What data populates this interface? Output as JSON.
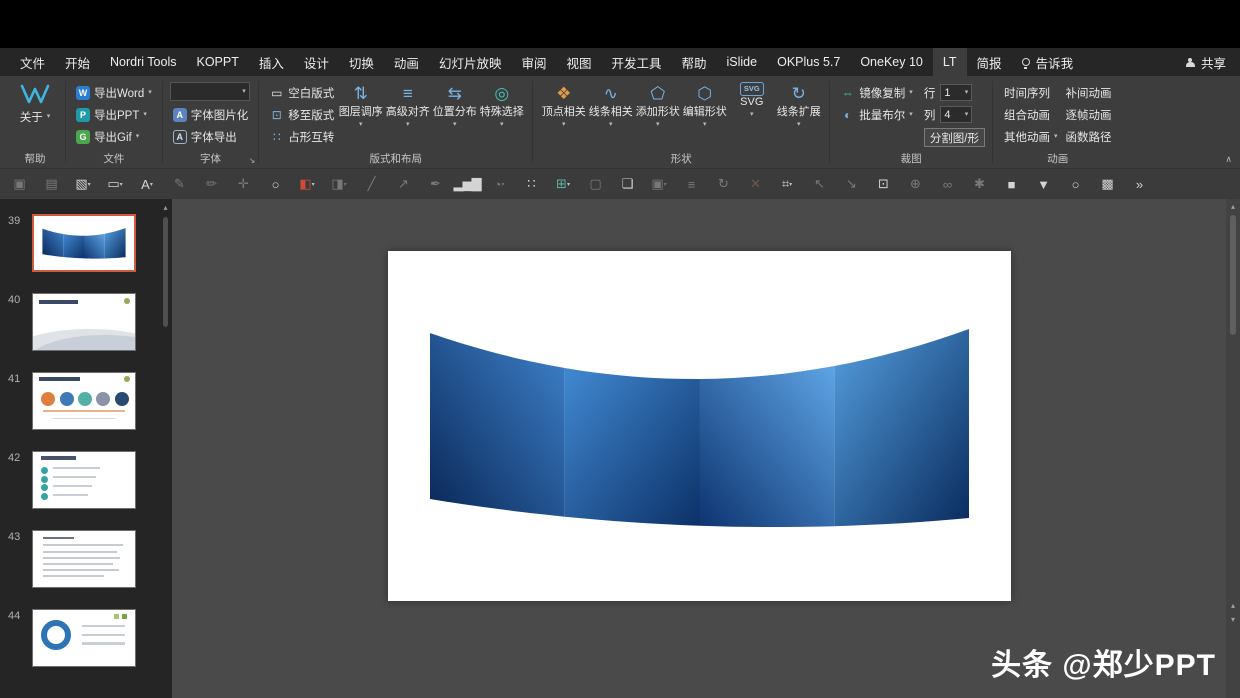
{
  "tabs": {
    "items": [
      "文件",
      "开始",
      "Nordri Tools",
      "KOPPT",
      "插入",
      "设计",
      "切换",
      "动画",
      "幻灯片放映",
      "审阅",
      "视图",
      "开发工具",
      "帮助",
      "iSlide",
      "OKPlus 5.7",
      "OneKey 10",
      "LT",
      "简报"
    ],
    "active": "LT",
    "tellme": "告诉我",
    "share": "共享"
  },
  "ribbon": {
    "about": {
      "button": "关于",
      "group_label": "帮助"
    },
    "file": {
      "group_label": "文件",
      "buttons": [
        {
          "icon": "W",
          "label": "导出Word"
        },
        {
          "icon": "P",
          "label": "导出PPT"
        },
        {
          "icon": "G",
          "label": "导出Gif"
        }
      ]
    },
    "font": {
      "group_label": "字体",
      "combo_value": "",
      "buttons": [
        {
          "icon": "A",
          "label": "字体图片化"
        },
        {
          "icon": "A",
          "label": "字体导出"
        }
      ]
    },
    "layout": {
      "group_label": "版式和布局",
      "small_buttons": [
        {
          "glyph": "▭",
          "label": "空白版式"
        },
        {
          "glyph": "⊡",
          "label": "移至版式"
        },
        {
          "glyph": "∷",
          "label": "占形互转"
        }
      ],
      "big_buttons": [
        {
          "glyph": "⇅",
          "label": "图层调序"
        },
        {
          "glyph": "≡",
          "label": "高级对齐"
        },
        {
          "glyph": "⇆",
          "label": "位置分布"
        },
        {
          "glyph": "◎",
          "label": "特殊选择"
        }
      ]
    },
    "shape": {
      "group_label": "形状",
      "big_buttons": [
        {
          "glyph": "❖",
          "label": "顶点相关"
        },
        {
          "glyph": "∿",
          "label": "线条相关"
        },
        {
          "glyph": "⬠",
          "label": "添加形状"
        },
        {
          "glyph": "⬡",
          "label": "编辑形状"
        },
        {
          "glyph": "SVG",
          "label": "SVG"
        },
        {
          "glyph": "↻",
          "label": "线条扩展"
        }
      ]
    },
    "crop": {
      "group_label": "裁图",
      "buttons": [
        {
          "glyph": "⇔",
          "label": "镜像复制"
        },
        {
          "glyph": "◐",
          "label": "批量布尔"
        }
      ],
      "row_label": "行",
      "row_value": "1",
      "col_label": "列",
      "col_value": "4",
      "split_button": "分割图/形"
    },
    "anim": {
      "group_label": "动画",
      "col1": [
        {
          "label": "时间序列"
        },
        {
          "label": "组合动画"
        },
        {
          "label": "其他动画"
        }
      ],
      "col2": [
        {
          "label": "补间动画"
        },
        {
          "label": "逐帧动画"
        },
        {
          "label": "函数路径"
        }
      ]
    }
  },
  "toolbar": {
    "icons": [
      {
        "name": "paste-icon",
        "glyph": "▣",
        "dim": true
      },
      {
        "name": "slide-layout-icon",
        "glyph": "▤",
        "dim": true
      },
      {
        "name": "image-placeholder-icon",
        "glyph": "▧",
        "caret": true
      },
      {
        "name": "textbox-icon",
        "glyph": "▭",
        "caret": true
      },
      {
        "name": "font-icon",
        "glyph": "A",
        "caret": true
      },
      {
        "name": "brush-icon",
        "glyph": "✎",
        "dim": true
      },
      {
        "name": "format-painter-icon",
        "glyph": "✏",
        "dim": true
      },
      {
        "name": "eyedropper-icon",
        "glyph": "✛",
        "dim": true
      },
      {
        "name": "circle-shape-icon",
        "glyph": "○"
      },
      {
        "name": "fill-color-icon",
        "glyph": "◧",
        "caret": true,
        "color": "#d04a3a"
      },
      {
        "name": "gradient-icon",
        "glyph": "◨",
        "dim": true,
        "caret": true
      },
      {
        "name": "line-icon",
        "glyph": "╱",
        "dim": true
      },
      {
        "name": "arrow-icon",
        "glyph": "↗",
        "dim": true
      },
      {
        "name": "ink-pen-icon",
        "glyph": "✒",
        "dim": true
      },
      {
        "name": "bar-chart-icon",
        "glyph": "▂▅▇"
      },
      {
        "name": "pie-chart-icon",
        "glyph": "◔",
        "dim": true,
        "caret": true
      },
      {
        "name": "dot-grid-icon",
        "glyph": "∷"
      },
      {
        "name": "table-icon",
        "glyph": "⊞",
        "caret": true,
        "color": "#5bb3a2"
      },
      {
        "name": "frame-icon",
        "glyph": "▢",
        "dim": true
      },
      {
        "name": "layers-icon",
        "glyph": "❏"
      },
      {
        "name": "group-icon",
        "glyph": "▣",
        "dim": true,
        "caret": true
      },
      {
        "name": "align-objects-icon",
        "glyph": "≡",
        "dim": true
      },
      {
        "name": "rotate-icon",
        "glyph": "↻",
        "dim": true
      },
      {
        "name": "delete-icon",
        "glyph": "✕",
        "dim": true,
        "color": "#c97b6e"
      },
      {
        "name": "crop-icon",
        "glyph": "⌗",
        "caret": true
      },
      {
        "name": "shrink-icon",
        "glyph": "↖",
        "dim": true
      },
      {
        "name": "expand-icon",
        "glyph": "↘",
        "dim": true
      },
      {
        "name": "selection-box-icon",
        "glyph": "⊡"
      },
      {
        "name": "zoom-icon",
        "glyph": "⊕",
        "dim": true
      },
      {
        "name": "link-icon",
        "glyph": "∞",
        "dim": true
      },
      {
        "name": "settings-icon",
        "glyph": "✱",
        "dim": true
      },
      {
        "name": "solid-square-icon",
        "glyph": "■"
      },
      {
        "name": "funnel-icon",
        "glyph": "▼"
      },
      {
        "name": "circle-outline-icon",
        "glyph": "○"
      },
      {
        "name": "picture-icon",
        "glyph": "▩"
      },
      {
        "name": "more-tools-icon",
        "glyph": "»"
      }
    ]
  },
  "slides": [
    {
      "number": "39",
      "kind": "screen",
      "selected": true
    },
    {
      "number": "40",
      "kind": "gray-wave"
    },
    {
      "number": "41",
      "kind": "photo-circles"
    },
    {
      "number": "42",
      "kind": "bullets"
    },
    {
      "number": "43",
      "kind": "text"
    },
    {
      "number": "44",
      "kind": "circle-diagram"
    }
  ],
  "shape": {
    "panels": [
      {
        "from": "#092757",
        "to": "#3f83cd"
      },
      {
        "from": "#4189d2",
        "to": "#0c3168"
      },
      {
        "from": "#0d3470",
        "to": "#5ea4e6"
      },
      {
        "from": "#55a0e0",
        "to": "#092b5e"
      }
    ]
  },
  "watermark": {
    "text": "头条 @郑少PPT"
  },
  "colors": {
    "titlebar": "#000000",
    "tabbar": "#262626",
    "ribbon": "#3d3d3d",
    "canvas": "#4a4a4a",
    "panel": "#252525",
    "slide": "#ffffff",
    "selection_border": "#cf5b3f"
  }
}
